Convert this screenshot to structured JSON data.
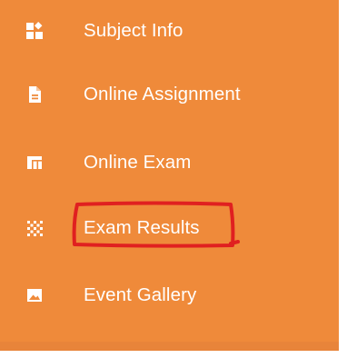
{
  "menu": {
    "items": [
      {
        "label": "Subject Info",
        "icon": "subject-info-icon"
      },
      {
        "label": "Online Assignment",
        "icon": "document-icon"
      },
      {
        "label": "Online Exam",
        "icon": "exam-layout-icon"
      },
      {
        "label": "Exam Results",
        "icon": "results-pattern-icon"
      },
      {
        "label": "Event Gallery",
        "icon": "image-icon"
      }
    ]
  },
  "colors": {
    "menu_background": "#ef8a3a",
    "text": "#ffffff",
    "annotation": "#e02020"
  }
}
